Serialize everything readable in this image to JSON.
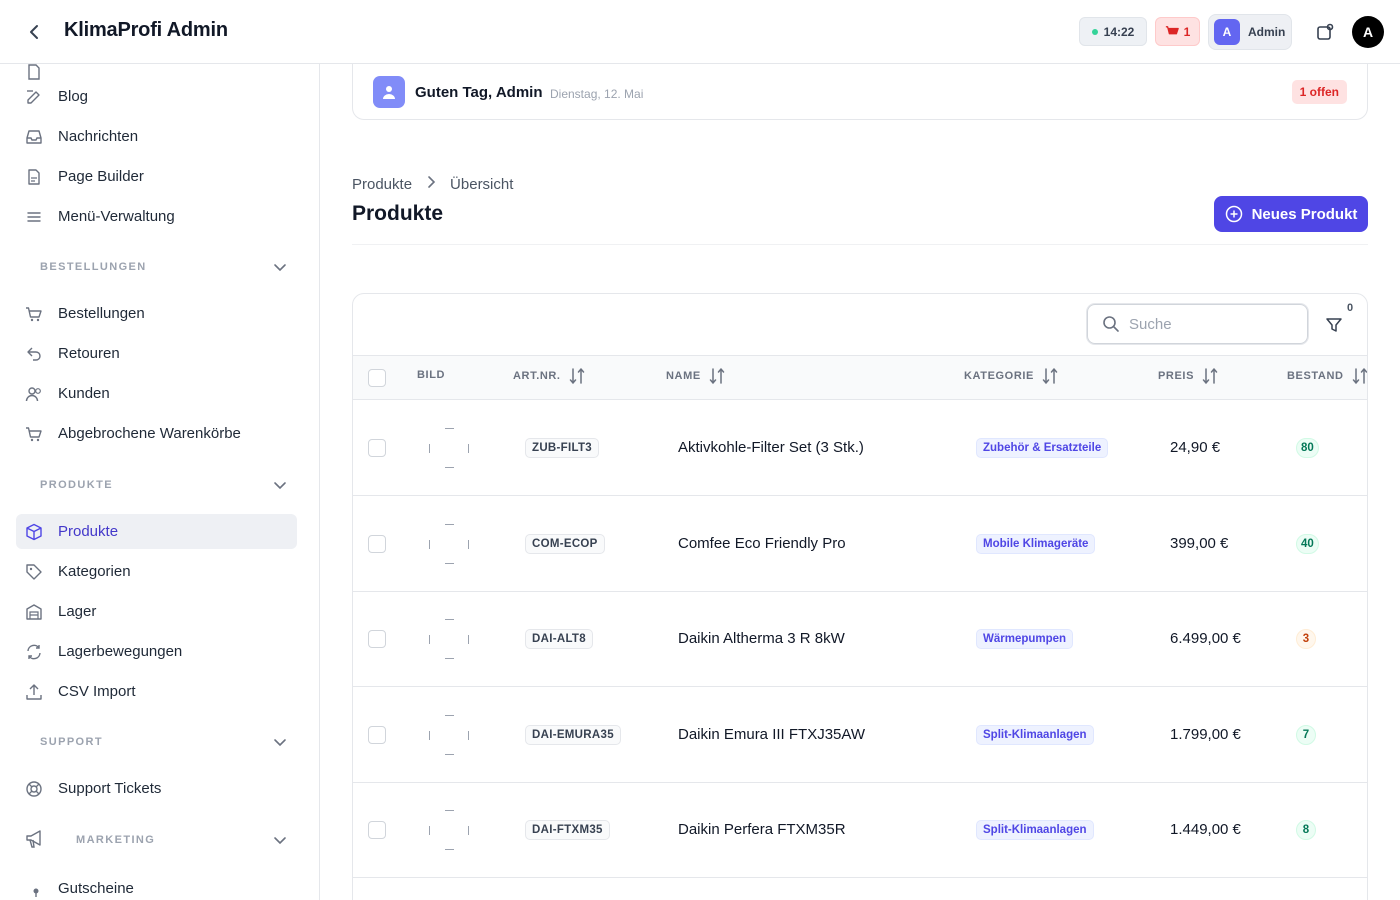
{
  "header": {
    "title": "KlimaProfi Admin",
    "clock": "14:22",
    "cart_count": "1",
    "admin_initial": "A",
    "admin_label": "Admin",
    "avatar_initial": "A"
  },
  "sidebar": {
    "items_top": [
      {
        "label": "Blog",
        "icon": "edit-icon"
      },
      {
        "label": "Nachrichten",
        "icon": "inbox-icon"
      },
      {
        "label": "Page Builder",
        "icon": "document-icon"
      },
      {
        "label": "Menü-Verwaltung",
        "icon": "menu-icon"
      }
    ],
    "sections": [
      {
        "title": "BESTELLUNGEN",
        "items": [
          {
            "label": "Bestellungen",
            "icon": "cart-icon"
          },
          {
            "label": "Retouren",
            "icon": "return-icon"
          },
          {
            "label": "Kunden",
            "icon": "users-icon"
          },
          {
            "label": "Abgebrochene Warenkörbe",
            "icon": "cart-icon"
          }
        ]
      },
      {
        "title": "PRODUKTE",
        "items": [
          {
            "label": "Produkte",
            "icon": "cube-icon",
            "active": true
          },
          {
            "label": "Kategorien",
            "icon": "tag-icon"
          },
          {
            "label": "Lager",
            "icon": "warehouse-icon"
          },
          {
            "label": "Lagerbewegungen",
            "icon": "refresh-icon"
          },
          {
            "label": "CSV Import",
            "icon": "upload-icon"
          }
        ]
      },
      {
        "title": "SUPPORT",
        "items": [
          {
            "label": "Support Tickets",
            "icon": "lifebuoy-icon"
          }
        ]
      },
      {
        "title": "MARKETING",
        "items": [
          {
            "label": "Gutscheine",
            "icon": "dot-icon"
          }
        ]
      }
    ]
  },
  "greeting": {
    "text": "Guten Tag, Admin",
    "date": "Dienstag, 12. Mai",
    "open_badge": "1 offen"
  },
  "breadcrumb": {
    "root": "Produkte",
    "current": "Übersicht"
  },
  "page": {
    "title": "Produkte",
    "new_button": "Neues Produkt"
  },
  "table": {
    "search_placeholder": "Suche",
    "filter_count": "0",
    "columns": [
      "BILD",
      "ART.NR.",
      "NAME",
      "KATEGORIE",
      "PREIS",
      "BESTAND"
    ],
    "rows": [
      {
        "sku": "ZUB-FILT3",
        "name": "Aktivkohle-Filter Set (3 Stk.)",
        "category": "Zubehör & Ersatzteile",
        "price": "24,90 €",
        "stock": "80",
        "stock_status": "ok"
      },
      {
        "sku": "COM-ECOP",
        "name": "Comfee Eco Friendly Pro",
        "category": "Mobile Klimageräte",
        "price": "399,00 €",
        "stock": "40",
        "stock_status": "ok"
      },
      {
        "sku": "DAI-ALT8",
        "name": "Daikin Altherma 3 R 8kW",
        "category": "Wärmepumpen",
        "price": "6.499,00 €",
        "stock": "3",
        "stock_status": "low"
      },
      {
        "sku": "DAI-EMURA35",
        "name": "Daikin Emura III FTXJ35AW",
        "category": "Split-Klimaanlagen",
        "price": "1.799,00 €",
        "stock": "7",
        "stock_status": "ok"
      },
      {
        "sku": "DAI-FTXM35",
        "name": "Daikin Perfera FTXM35R",
        "category": "Split-Klimaanlagen",
        "price": "1.449,00 €",
        "stock": "8",
        "stock_status": "ok"
      }
    ]
  },
  "colors": {
    "accent": "#4f46e5",
    "danger": "#dc2626",
    "success": "#047857",
    "warning": "#c2410c"
  }
}
